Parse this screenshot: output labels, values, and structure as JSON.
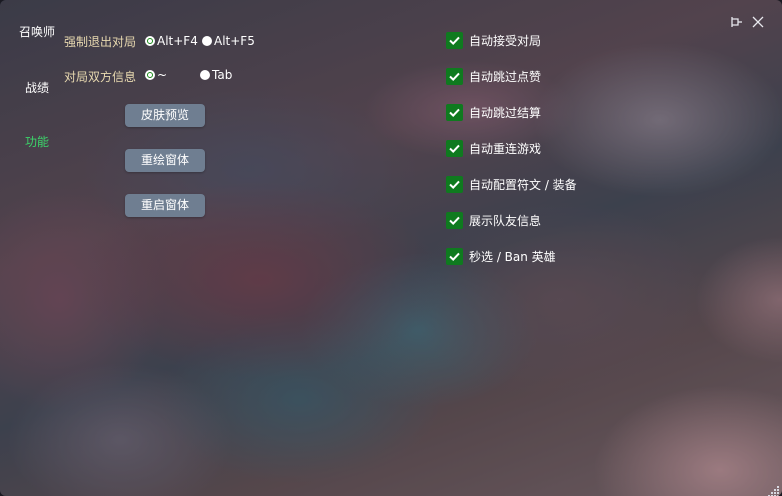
{
  "sidebar": {
    "items": [
      {
        "label": "召唤师",
        "active": false
      },
      {
        "label": "战绩",
        "active": false
      },
      {
        "label": "功能",
        "active": true
      }
    ]
  },
  "titlebar": {
    "pin_icon": "pin-icon",
    "close_icon": "close-icon"
  },
  "options": {
    "force_quit": {
      "label": "强制退出对局",
      "choices": [
        "Alt+F4",
        "Alt+F5"
      ],
      "selected": "Alt+F4"
    },
    "team_info": {
      "label": "对局双方信息",
      "choices": [
        "~",
        "Tab"
      ],
      "selected": "~"
    }
  },
  "buttons": {
    "skin_preview": "皮肤预览",
    "redraw_window": "重绘窗体",
    "restart_window": "重启窗体"
  },
  "checks": [
    {
      "label": "自动接受对局",
      "checked": true
    },
    {
      "label": "自动跳过点赞",
      "checked": true
    },
    {
      "label": "自动跳过结算",
      "checked": true
    },
    {
      "label": "自动重连游戏",
      "checked": true
    },
    {
      "label": "自动配置符文 / 装备",
      "checked": true
    },
    {
      "label": "展示队友信息",
      "checked": true
    },
    {
      "label": "秒选 / Ban 英雄",
      "checked": true
    }
  ],
  "colors": {
    "accent_active": "#3cd56a",
    "option_label": "#e8d9b0",
    "button_bg": "#6f7e91",
    "checkbox_bg": "#0f7a1f"
  }
}
